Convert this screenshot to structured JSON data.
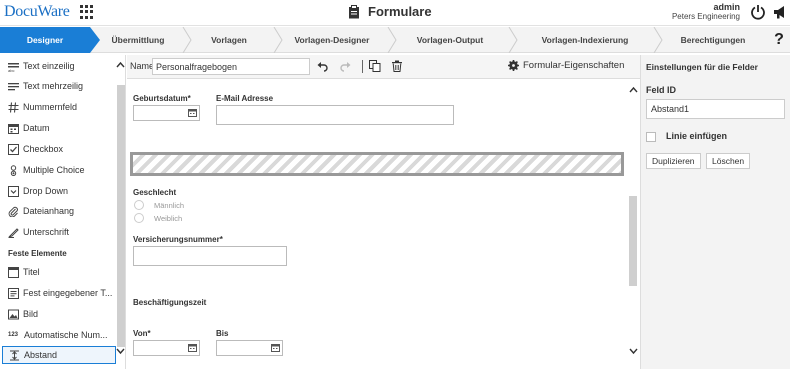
{
  "header": {
    "logo": "DocuWare",
    "title": "Formulare",
    "user_name": "admin",
    "user_org": "Peters Engineering"
  },
  "steps": [
    "Designer",
    "Übermittlung",
    "Vorlagen",
    "Vorlagen-Designer",
    "Vorlagen-Output",
    "Vorlagen-Indexierung",
    "Berechtigungen"
  ],
  "help": "?",
  "sidebar": {
    "items": [
      {
        "label": "Text einzeilig",
        "icon": "single-line-text-icon"
      },
      {
        "label": "Text mehrzeilig",
        "icon": "multi-line-text-icon"
      },
      {
        "label": "Nummernfeld",
        "icon": "hash-icon"
      },
      {
        "label": "Datum",
        "icon": "calendar-icon"
      },
      {
        "label": "Checkbox",
        "icon": "checkbox-icon"
      },
      {
        "label": "Multiple Choice",
        "icon": "multiple-choice-icon"
      },
      {
        "label": "Drop Down",
        "icon": "dropdown-icon"
      },
      {
        "label": "Dateianhang",
        "icon": "paperclip-icon"
      },
      {
        "label": "Unterschrift",
        "icon": "signature-icon"
      }
    ],
    "section": "Feste Elemente",
    "fixed_items": [
      {
        "label": "Titel",
        "icon": "title-icon"
      },
      {
        "label": "Fest eingegebener T...",
        "icon": "fixed-text-icon"
      },
      {
        "label": "Bild",
        "icon": "image-icon"
      },
      {
        "label": "Automatische Num...",
        "icon": "auto-number-icon"
      },
      {
        "label": "Abstand",
        "icon": "spacer-icon",
        "selected": true
      }
    ],
    "auto_number_glyph": "123"
  },
  "toolbar": {
    "name_label": "Name",
    "name_value": "Personalfragebogen",
    "properties_label": "Formular-Eigenschaften"
  },
  "form": {
    "birthdate_label": "Geburtsdatum*",
    "email_label": "E-Mail Adresse",
    "gender_label": "Geschlecht",
    "gender_options": [
      "Männlich",
      "Weiblich"
    ],
    "insurance_label": "Versicherungsnummer*",
    "employment_label": "Beschäftigungszeit",
    "from_label": "Von*",
    "to_label": "Bis"
  },
  "right_panel": {
    "title": "Einstellungen für die Felder",
    "field_id_label": "Feld ID",
    "field_id_value": "Abstand1",
    "line_label": "Linie einfügen",
    "duplicate_label": "Duplizieren",
    "delete_label": "Löschen"
  },
  "colors": {
    "accent": "#1a7ed6",
    "logo": "#1a6fc4"
  }
}
